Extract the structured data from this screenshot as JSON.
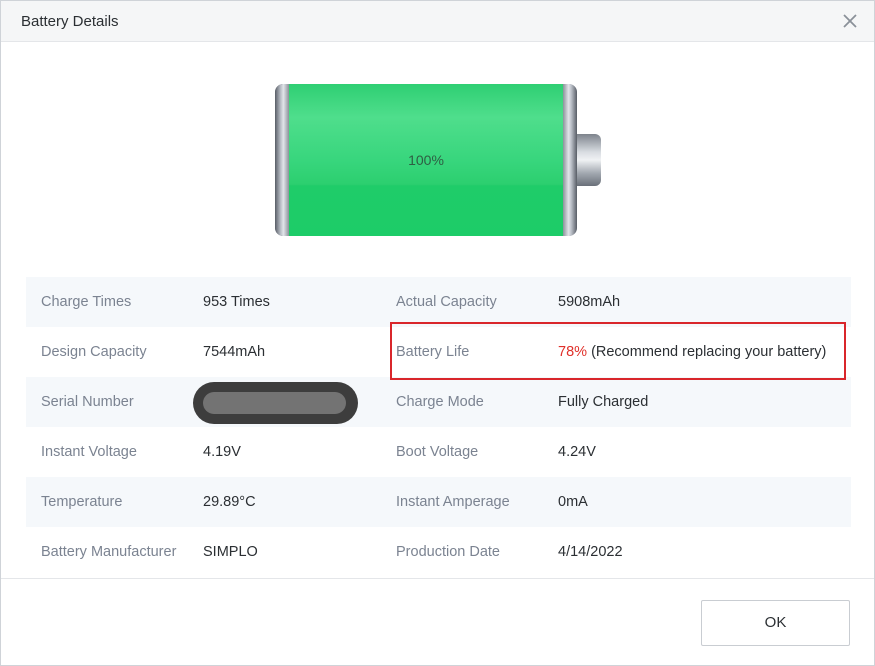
{
  "dialog": {
    "title": "Battery Details",
    "ok_label": "OK"
  },
  "battery": {
    "level_label": "100%",
    "level_fraction": 1.0,
    "fill_color": "#1dcc68"
  },
  "details": {
    "rows": [
      {
        "l1": "Charge Times",
        "v1": "953 Times",
        "l2": "Actual Capacity",
        "v2": "5908mAh"
      },
      {
        "l1": "Design Capacity",
        "v1": "7544mAh",
        "l2": "Battery Life",
        "v2_pct": "78%",
        "v2_note": "(Recommend replacing your battery)"
      },
      {
        "l1": "Serial Number",
        "v1": "",
        "l2": "Charge Mode",
        "v2": "Fully Charged"
      },
      {
        "l1": "Instant Voltage",
        "v1": "4.19V",
        "l2": "Boot Voltage",
        "v2": "4.24V"
      },
      {
        "l1": "Temperature",
        "v1": "29.89°C",
        "l2": "Instant Amperage",
        "v2": "0mA"
      },
      {
        "l1": "Battery Manufacturer",
        "v1": "SIMPLO",
        "l2": "Production Date",
        "v2": "4/14/2022"
      }
    ]
  },
  "colors": {
    "warning": "#e0302a",
    "highlight": "#d9262b"
  },
  "icons": {
    "close": "close-icon"
  }
}
